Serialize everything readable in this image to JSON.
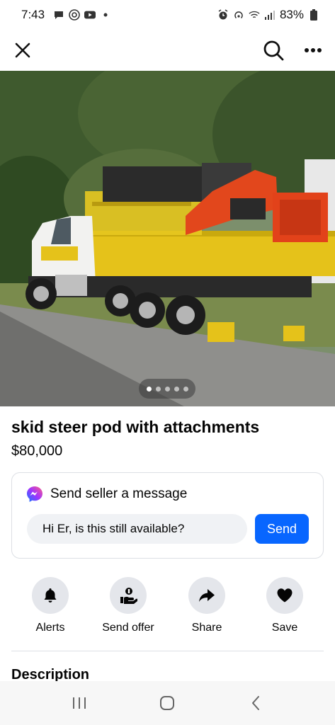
{
  "status": {
    "time": "7:43",
    "battery": "83%",
    "left_icons": [
      "chat-bubble-icon",
      "at-sign-icon",
      "youtube-icon",
      "dot-icon"
    ],
    "right_icons": [
      "alarm-icon",
      "hotspot-icon",
      "wifi-icon",
      "signal-icon",
      "battery-icon"
    ]
  },
  "listing": {
    "title": "skid steer pod with attachments",
    "price": "$80,000",
    "photo_count": 5,
    "photo_index": 1
  },
  "message": {
    "heading": "Send seller a message",
    "input_value": "Hi Er, is this still available?",
    "send_label": "Send"
  },
  "actions": [
    {
      "label": "Alerts",
      "icon": "bell-icon"
    },
    {
      "label": "Send offer",
      "icon": "offer-icon"
    },
    {
      "label": "Share",
      "icon": "share-arrow-icon"
    },
    {
      "label": "Save",
      "icon": "heart-icon"
    }
  ],
  "section": {
    "description_title": "Description"
  },
  "colors": {
    "primary": "#0866ff",
    "action_bg": "#e4e6eb",
    "input_bg": "#f0f2f5"
  }
}
